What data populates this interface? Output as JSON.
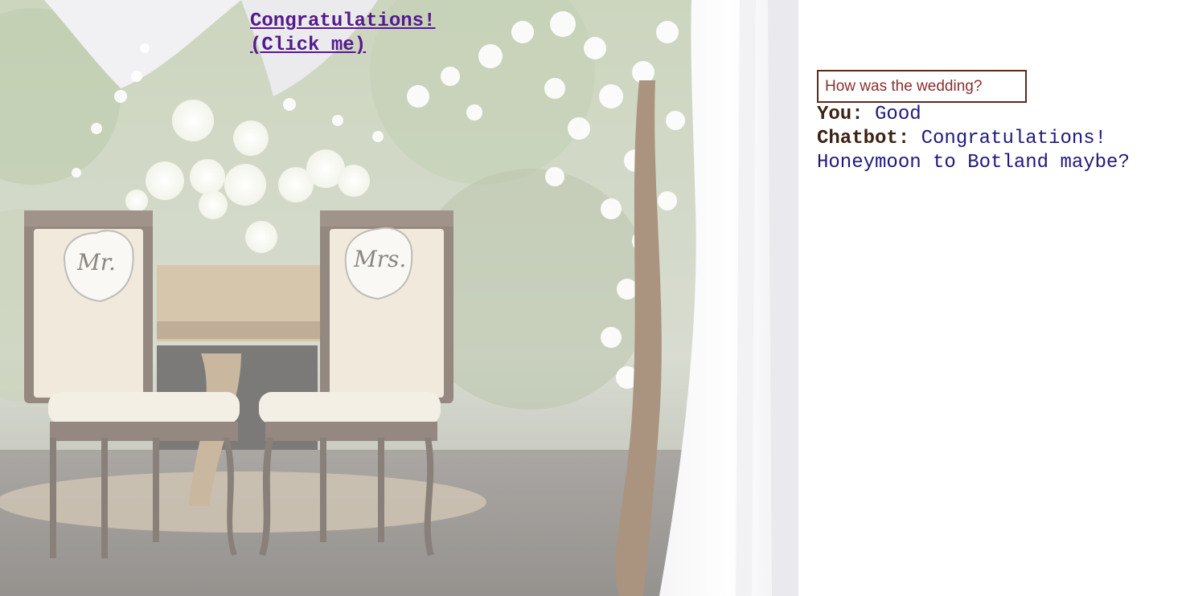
{
  "hero": {
    "link_line1": "Congratulations!",
    "link_line2": "(Click me)",
    "chair_left_sign": "Mr.",
    "chair_right_sign": "Mrs."
  },
  "chat": {
    "input_placeholder": "How was the wedding?",
    "messages": [
      {
        "speaker": "You:",
        "text": "Good"
      },
      {
        "speaker": "Chatbot:",
        "text": "Congratulations! Honeymoon to Botland maybe?"
      }
    ]
  },
  "colors": {
    "link": "#551a8b",
    "speaker": "#3b2314",
    "message": "#1f1a7a",
    "input_border": "#5a2a1e"
  }
}
